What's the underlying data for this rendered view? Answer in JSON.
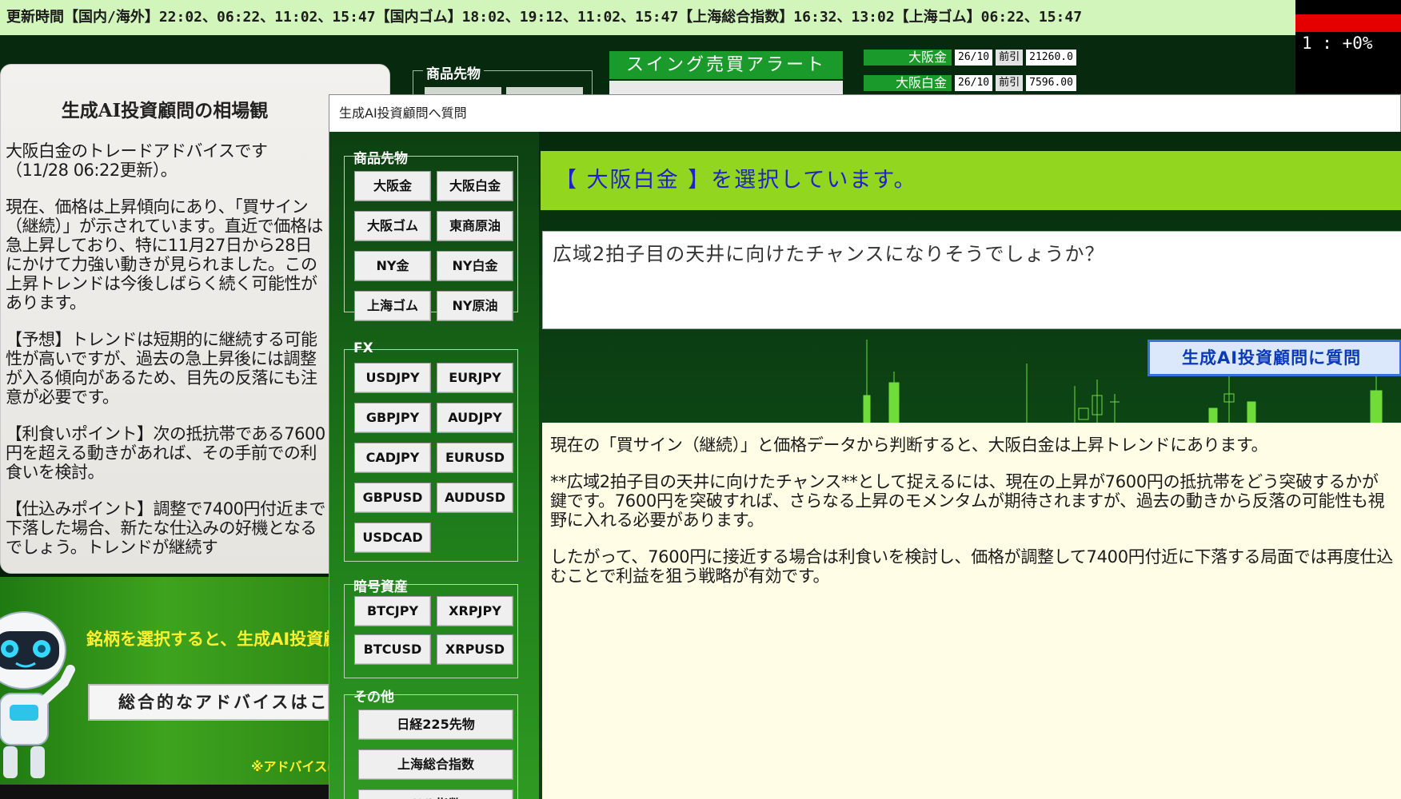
{
  "ticker": "更新時間【国内/海外】22:02、06:22、11:02、15:47【国内ゴム】18:02、19:12、11:02、15:47【上海総合指数】16:32、13:02【上海ゴム】06:22、15:47",
  "top_right": {
    "rate": "1 : +0%"
  },
  "main_bg": {
    "commodity_legend": "商品先物",
    "alert_title": "スイング売買アラート",
    "quotes": [
      {
        "name": "大阪金",
        "date": "26/10",
        "type": "前引",
        "price": "21260.0"
      },
      {
        "name": "大阪白金",
        "date": "26/10",
        "type": "前引",
        "price": "7596.00"
      }
    ]
  },
  "left_panel": {
    "title": "生成AI投資顧問の相場観",
    "paragraphs": [
      "大阪白金のトレードアドバイスです（11/28 06:22更新）。",
      "現在、価格は上昇傾向にあり、「買サイン（継続）」が示されています。直近で価格は急上昇しており、特に11月27日から28日にかけて力強い動きが見られました。この上昇トレンドは今後しばらく続く可能性があります。",
      "【予想】トレンドは短期的に継続する可能性が高いですが、過去の急上昇後には調整が入る傾向があるため、目先の反落にも注意が必要です。",
      "【利食いポイント】次の抵抗帯である7600円を超える動きがあれば、その手前での利食いを検討。",
      "【仕込みポイント】調整で7400円付近まで下落した場合、新たな仕込みの好機となるでしょう。トレンドが継続す"
    ],
    "robot_message": "銘柄を選択すると、生成AI投資顧問からのアドバイスが表示されます。",
    "summary_button": "総合的なアドバイスはこちら",
    "note": "※アドバイスは"
  },
  "dialog": {
    "title": "生成AI投資顧問へ質問",
    "groups": [
      {
        "legend": "商品先物",
        "buttons": [
          "大阪金",
          "大阪白金",
          "大阪ゴム",
          "東商原油",
          "NY金",
          "NY白金",
          "上海ゴム",
          "NY原油"
        ]
      },
      {
        "legend": "FX",
        "buttons": [
          "USDJPY",
          "EURJPY",
          "GBPJPY",
          "AUDJPY",
          "CADJPY",
          "EURUSD",
          "GBPUSD",
          "AUDUSD",
          "USDCAD"
        ]
      },
      {
        "legend": "暗号資産",
        "buttons": [
          "BTCJPY",
          "XRPJPY",
          "BTCUSD",
          "XRPUSD"
        ]
      },
      {
        "legend": "その他",
        "buttons": [
          "日経225先物",
          "上海総合指数",
          "ドル指数"
        ]
      }
    ],
    "selected_text": "【 大阪白金 】を選択しています。",
    "question": "広域2拍子目の天井に向けたチャンスになりそうでしょうか？",
    "ask_button": "生成AI投資顧問に質問",
    "answer": [
      "現在の「買サイン（継続）」と価格データから判断すると、大阪白金は上昇トレンドにあります。",
      "**広域2拍子目の天井に向けたチャンス**として捉えるには、現在の上昇が7600円の抵抗帯をどう突破するかが鍵です。7600円を突破すれば、さらなる上昇のモメンタムが期待されますが、過去の動きから反落の可能性も視野に入れる必要があります。",
      "したがって、7600円に接近する場合は利食いを検討し、価格が調整して7400円付近に下落する局面では再度仕込むことで利益を狙う戦略が有効です。"
    ]
  }
}
